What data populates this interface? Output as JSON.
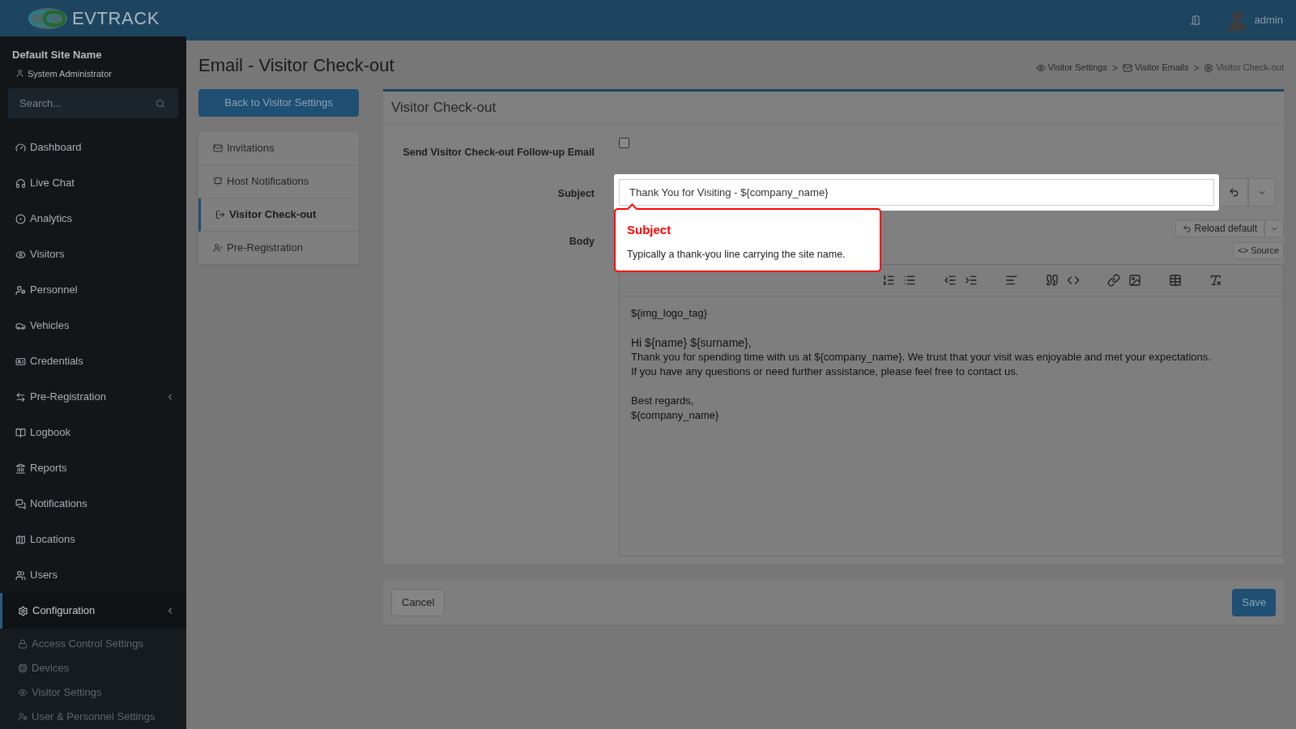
{
  "header": {
    "logo": "**EV**TRACK",
    "user": "admin"
  },
  "sidebar": {
    "site_name": "Default Site Name",
    "role": "System Administrator",
    "search_placeholder": "Search...",
    "items": [
      {
        "label": "Dashboard",
        "selected": false,
        "expandable": false
      },
      {
        "label": "Live Chat",
        "selected": false,
        "expandable": false
      },
      {
        "label": "Analytics",
        "selected": false,
        "expandable": false
      },
      {
        "label": "Visitors",
        "selected": false,
        "expandable": false
      },
      {
        "label": "Personnel",
        "selected": false,
        "expandable": false
      },
      {
        "label": "Vehicles",
        "selected": false,
        "expandable": false
      },
      {
        "label": "Credentials",
        "selected": false,
        "expandable": false
      },
      {
        "label": "Pre-Registration",
        "selected": false,
        "expandable": true
      },
      {
        "label": "Logbook",
        "selected": false,
        "expandable": false
      },
      {
        "label": "Reports",
        "selected": false,
        "expandable": false
      },
      {
        "label": "Notifications",
        "selected": false,
        "expandable": false
      },
      {
        "label": "Locations",
        "selected": false,
        "expandable": false
      },
      {
        "label": "Users",
        "selected": false,
        "expandable": false
      },
      {
        "label": "Configuration",
        "selected": true,
        "expandable": true
      }
    ],
    "sub_items": [
      "Access Control Settings",
      "Devices",
      "Visitor Settings",
      "User & Personnel Settings"
    ]
  },
  "page": {
    "title": "Email - Visitor Check-out",
    "breadcrumbs": {
      "separator": ">",
      "items": [
        "Visitor Settings",
        "Visitor Emails",
        "Visitor Check-out"
      ]
    },
    "back_button": "Back to Visitor Settings"
  },
  "tabs": [
    {
      "label": "Invitations",
      "selected": false
    },
    {
      "label": "Host Notifications",
      "selected": false
    },
    {
      "label": "Visitor Check-out",
      "selected": true
    },
    {
      "label": "Pre-Registration",
      "selected": false
    }
  ],
  "card": {
    "title": "Visitor Check-out",
    "follow_up": {
      "label": "Send Visitor Check-out Follow-up Email",
      "checked": false
    },
    "subject": {
      "label": "Subject",
      "value": "Thank You for Visiting - ${company_name}"
    },
    "body": {
      "label": "Body",
      "reload_button": "Reload default",
      "source_button": "Source",
      "source_mark": "<>",
      "paragraphs": [
        [
          "${img_logo_tag}"
        ],
        [
          "Hi ${name} ${surname},",
          "Thank you for spending time with us at ${company_name}. We trust that your visit was enjoyable and met your expectations.",
          "If you have any questions or need further assistance, please feel free to contact us."
        ],
        [
          "Best regards,",
          "${company_name}"
        ]
      ]
    }
  },
  "tour": {
    "title": "Subject",
    "text": "Typically a thank-you line carrying the site name."
  },
  "footer": {
    "cancel": "Cancel",
    "save": "Save"
  }
}
